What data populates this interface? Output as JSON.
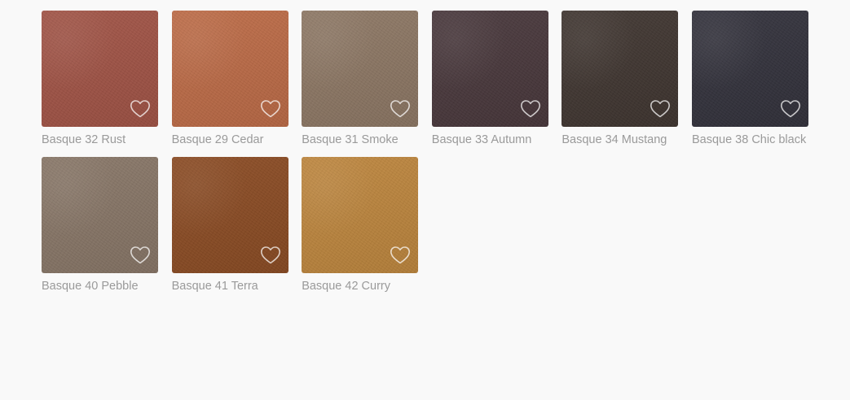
{
  "swatches": [
    {
      "label": "Basque 32 Rust",
      "color": "#a05244"
    },
    {
      "label": "Basque 29 Cedar",
      "color": "#bc6a45"
    },
    {
      "label": "Basque 31 Smoke",
      "color": "#8c7663"
    },
    {
      "label": "Basque 33 Autumn",
      "color": "#47363a"
    },
    {
      "label": "Basque 34 Mustang",
      "color": "#3e342f"
    },
    {
      "label": "Basque 38 Chic black",
      "color": "#31303a"
    },
    {
      "label": "Basque 40 Pebble",
      "color": "#877566"
    },
    {
      "label": "Basque 41 Terra",
      "color": "#8a4a22"
    },
    {
      "label": "Basque 42 Curry",
      "color": "#bd853c"
    }
  ],
  "favorite_icon": "heart-outline-icon"
}
